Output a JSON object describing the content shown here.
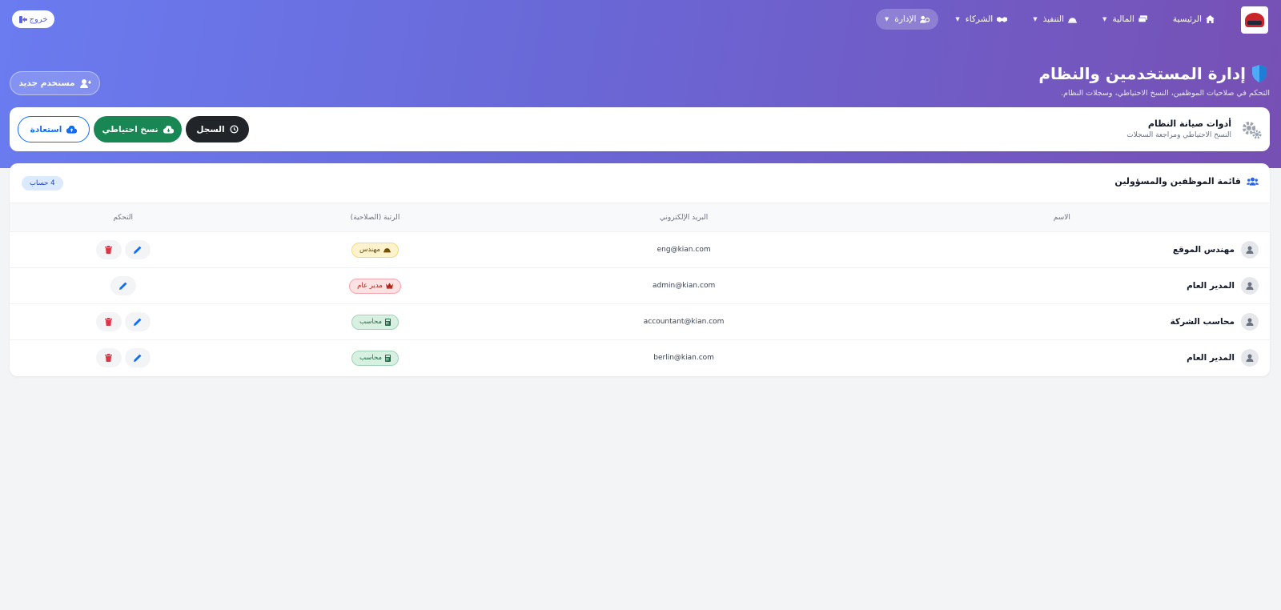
{
  "nav": {
    "items": [
      {
        "label": "الرئيسية",
        "icon": "home-icon",
        "dropdown": false,
        "active": false
      },
      {
        "label": "المالية",
        "icon": "money-icon",
        "dropdown": true,
        "active": false
      },
      {
        "label": "التنفيذ",
        "icon": "helmet-icon",
        "dropdown": true,
        "active": false
      },
      {
        "label": "الشركاء",
        "icon": "handshake-icon",
        "dropdown": true,
        "active": false
      },
      {
        "label": "الإدارة",
        "icon": "users-gear-icon",
        "dropdown": true,
        "active": true
      }
    ],
    "logout_label": "خروج"
  },
  "header": {
    "title": "إدارة المستخدمين والنظام",
    "subtitle": "التحكم في صلاحيات الموظفين، النسخ الاحتياطي، وسجلات النظام.",
    "new_user_label": "مستخدم جديد"
  },
  "tools": {
    "title": "أدوات صيانة النظام",
    "subtitle": "النسخ الاحتياطي ومراجعة السجلات",
    "log_label": "السجل",
    "backup_label": "نسخ احتياطي",
    "restore_label": "استعادة"
  },
  "users": {
    "title": "قائمة الموظفين والمسؤولين",
    "count_label": "4 حساب",
    "columns": {
      "name": "الاسم",
      "email": "البريد الإلكتروني",
      "role": "الرتبة (الصلاحية)",
      "actions": "التحكم"
    },
    "rows": [
      {
        "name": "مهندس الموقع",
        "email": "eng@kian.com",
        "role": "مهندس",
        "role_icon": "helmet-icon",
        "can_delete": true
      },
      {
        "name": "المدير العام",
        "email": "admin@kian.com",
        "role": "مدير عام",
        "role_icon": "crown-icon",
        "can_delete": false
      },
      {
        "name": "محاسب الشركة",
        "email": "accountant@kian.com",
        "role": "محاسب",
        "role_icon": "calculator-icon",
        "can_delete": true
      },
      {
        "name": "المدير العام",
        "email": "berlin@kian.com",
        "role": "محاسب",
        "role_icon": "calculator-icon",
        "can_delete": true
      }
    ]
  },
  "colors": {
    "gradient_start": "#6a7cf0",
    "gradient_end": "#7750b4",
    "primary": "#0d6efd",
    "success": "#198754",
    "dark": "#212529",
    "danger": "#dc3545"
  }
}
